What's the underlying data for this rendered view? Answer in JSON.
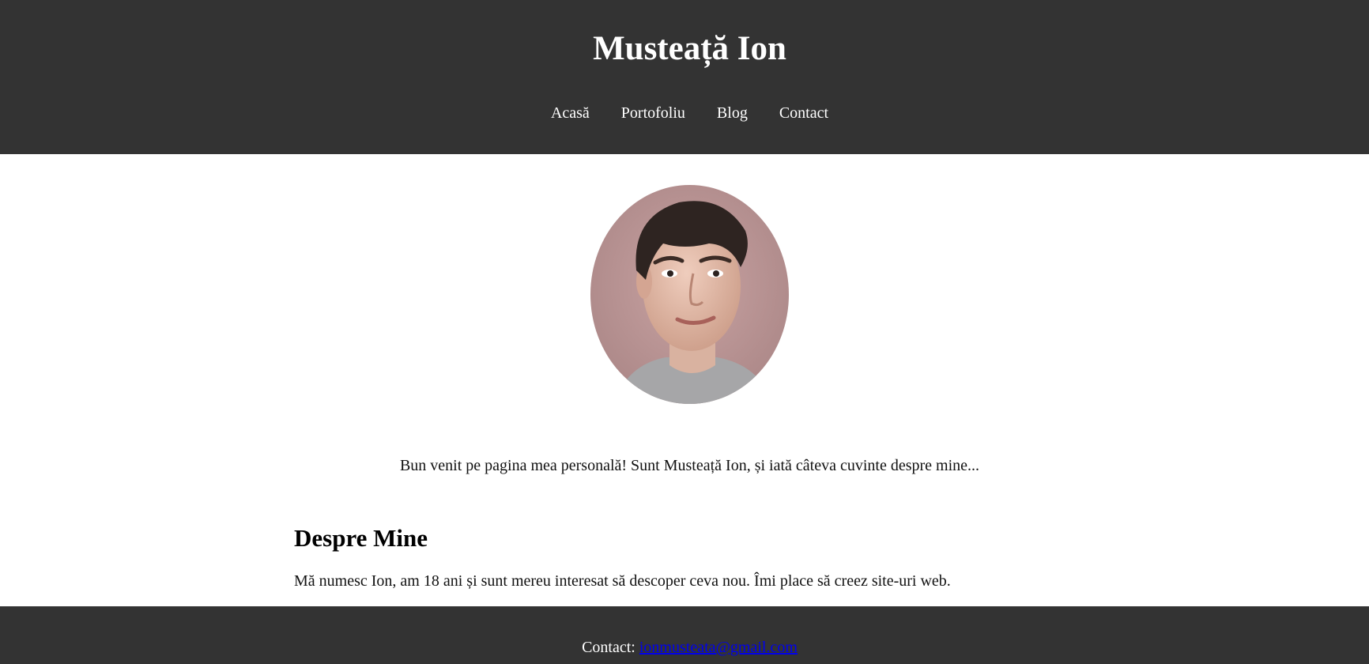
{
  "header": {
    "title": "Musteață Ion",
    "nav": [
      {
        "label": "Acasă"
      },
      {
        "label": "Portofoliu"
      },
      {
        "label": "Blog"
      },
      {
        "label": "Contact"
      }
    ]
  },
  "main": {
    "intro": "Bun venit pe pagina mea personală! Sunt Musteață Ion, și iată câteva cuvinte despre mine...",
    "about_title": "Despre Mine",
    "about_text": "Mă numesc Ion, am 18 ani și sunt mereu interesat să descoper ceva nou. Îmi place să creez site-uri web."
  },
  "footer": {
    "contact_label": "Contact:",
    "email": "ionmusteata@gmail.com"
  },
  "colors": {
    "header_bg": "#333333",
    "footer_bg": "#333333",
    "link": "#0000ee"
  }
}
